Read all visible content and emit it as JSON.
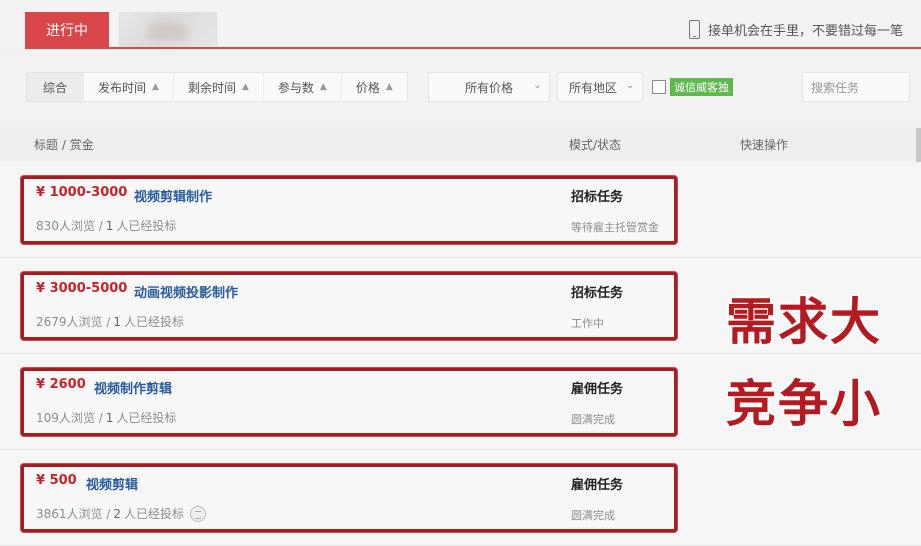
{
  "tabs": {
    "active_label": "进行中"
  },
  "slogan": "接单机会在手里，不要错过每一笔",
  "filters": {
    "sort_items": [
      {
        "label": "综合"
      },
      {
        "label": "发布时间"
      },
      {
        "label": "剩余时间"
      },
      {
        "label": "参与数"
      },
      {
        "label": "价格"
      }
    ],
    "price_select": "所有价格",
    "region_select": "所有地区",
    "honest_badge": "诚信威客独",
    "search_placeholder": "搜索任务"
  },
  "table_header": {
    "title_col": "标题 / 赏金",
    "mode_col": "模式/状态",
    "actions_col": "快速操作"
  },
  "tasks": [
    {
      "price": "¥ 1000-3000",
      "title": "视频剪辑制作",
      "views": "830",
      "views_suffix": "人浏览 /",
      "bids": "1",
      "bids_suffix": "人已经投标",
      "mode": "招标任务",
      "status": "等待雇主托管赏金"
    },
    {
      "price": "¥ 3000-5000",
      "title": "动画视频投影制作",
      "views": "2679",
      "views_suffix": "人浏览 /",
      "bids": "1",
      "bids_suffix": "人已经投标",
      "mode": "招标任务",
      "status": "工作中"
    },
    {
      "price": "¥ 2600",
      "title": "视频制作剪辑",
      "views": "109",
      "views_suffix": "人浏览 /",
      "bids": "1",
      "bids_suffix": "人已经投标",
      "mode": "雇佣任务",
      "status": "圆满完成"
    },
    {
      "price": "¥ 500",
      "title": "视频剪辑",
      "views": "3861",
      "views_suffix": "人浏览 /",
      "bids": "2",
      "bids_suffix": "人已经投标",
      "mode": "雇佣任务",
      "status": "圆满完成"
    }
  ],
  "overlay": {
    "line1": "需求大",
    "line2": "竞争小"
  },
  "colors": {
    "accent_red": "#d9474b",
    "highlight_border": "#a51d23",
    "price_red": "#c4252b",
    "title_blue": "#2a5c9e",
    "badge_green": "#5fb84f"
  }
}
